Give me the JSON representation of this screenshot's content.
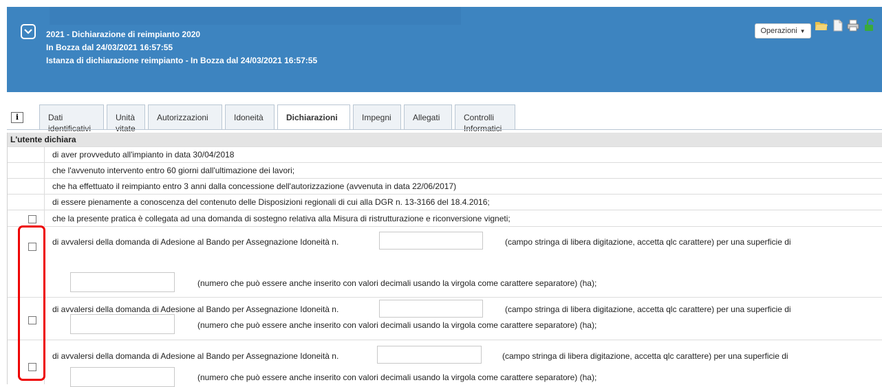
{
  "header": {
    "line1": "2021 - Dichiarazione di reimpianto 2020",
    "line2": "In Bozza dal 24/03/2021 16:57:55",
    "line3": "Istanza di dichiarazione reimpianto - In Bozza dal 24/03/2021 16:57:55",
    "operations_label": "Operazioni",
    "colors": {
      "header_bg": "#3d84c0",
      "highlight": "#e00000"
    }
  },
  "info_label": "i",
  "tabs": [
    {
      "line1": "Dati",
      "line2": "identificativi"
    },
    {
      "line1": "Unità",
      "line2": "vitate"
    },
    {
      "line1": "Autorizzazioni",
      "line2": ""
    },
    {
      "line1": "Idoneità",
      "line2": ""
    },
    {
      "line1": "Dichiarazioni",
      "line2": ""
    },
    {
      "line1": "Impegni",
      "line2": ""
    },
    {
      "line1": "Allegati",
      "line2": ""
    },
    {
      "line1": "Controlli",
      "line2": "Informatici"
    }
  ],
  "active_tab": "Dichiarazioni",
  "table": {
    "title": "L'utente dichiara",
    "rows": [
      "di aver provveduto all'impianto in data 30/04/2018",
      "che l'avvenuto intervento entro 60 giorni dall'ultimazione dei lavori;",
      "che ha effettuato il reimpianto entro 3 anni dalla concessione dell'autorizzazione (avvenuta in data 22/06/2017)",
      "di essere pienamente a conoscenza del contenuto delle Disposizioni regionali di cui alla DGR n. 13-3166 del 18.4.2016;",
      "che la presente pratica è collegata ad una domanda di sostegno relativa alla Misura di ristrutturazione e riconversione vigneti;"
    ],
    "adesione": {
      "text_a": "di avvalersi della domanda di Adesione al Bando per Assegnazione Idoneità n.",
      "text_b": "(campo stringa di libera digitazione, accetta qlc carattere) per una superficie di",
      "text_c": "(numero che può essere anche inserito con valori decimali usando la virgola come carattere separatore) (ha);"
    }
  }
}
